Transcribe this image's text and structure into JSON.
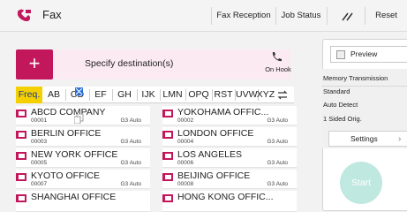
{
  "app": {
    "title": "Fax",
    "icon": "fax-machine-icon"
  },
  "header": {
    "fax_reception": "Fax Reception",
    "job_status": "Job Status",
    "reset": "Reset",
    "tools_icon": "tools-icon"
  },
  "destination": {
    "add_icon": "plus-icon",
    "add_symbol": "+",
    "label": "Specify destination(s)",
    "on_hook": "On Hook",
    "on_hook_icon": "phone-icon"
  },
  "tabs": [
    {
      "label": "Freq.",
      "active": true
    },
    {
      "label": "AB"
    },
    {
      "label": "CD"
    },
    {
      "label": "EF"
    },
    {
      "label": "GH"
    },
    {
      "label": "IJK"
    },
    {
      "label": "LMN"
    },
    {
      "label": "OPQ"
    },
    {
      "label": "RST"
    },
    {
      "label": "UVW"
    },
    {
      "label": "XYZ"
    }
  ],
  "swap_icon": "swap-icon",
  "entries": [
    {
      "name": "ABCD COMPANY",
      "number": "00001",
      "mode": "G3 Auto"
    },
    {
      "name": "YOKOHAMA OFFIC...",
      "number": "00002",
      "mode": "G3 Auto"
    },
    {
      "name": "BERLIN OFFICE",
      "number": "00003",
      "mode": "G3 Auto"
    },
    {
      "name": "LONDON OFFICE",
      "number": "00004",
      "mode": "G3 Auto"
    },
    {
      "name": "NEW YORK OFFICE",
      "number": "00005",
      "mode": "G3 Auto"
    },
    {
      "name": "LOS ANGELES",
      "number": "00006",
      "mode": "G3 Auto"
    },
    {
      "name": "KYOTO OFFICE",
      "number": "00007",
      "mode": "G3 Auto"
    },
    {
      "name": "BEIJING OFFICE",
      "number": "00008",
      "mode": "G3 Auto"
    },
    {
      "name": "SHANGHAI  OFFICE",
      "number": "",
      "mode": ""
    },
    {
      "name": "HONG KONG OFFIC...",
      "number": "",
      "mode": ""
    }
  ],
  "panel": {
    "preview": "Preview",
    "memory_transmission": "Memory Transmission",
    "standard": "Standard",
    "auto_detect": "Auto Detect",
    "sided": "1 Sided Orig.",
    "settings": "Settings",
    "start": "Start"
  },
  "colors": {
    "accent_pink": "#c2185b",
    "tab_active": "#f5d000",
    "start_button": "#bfe8e0"
  }
}
